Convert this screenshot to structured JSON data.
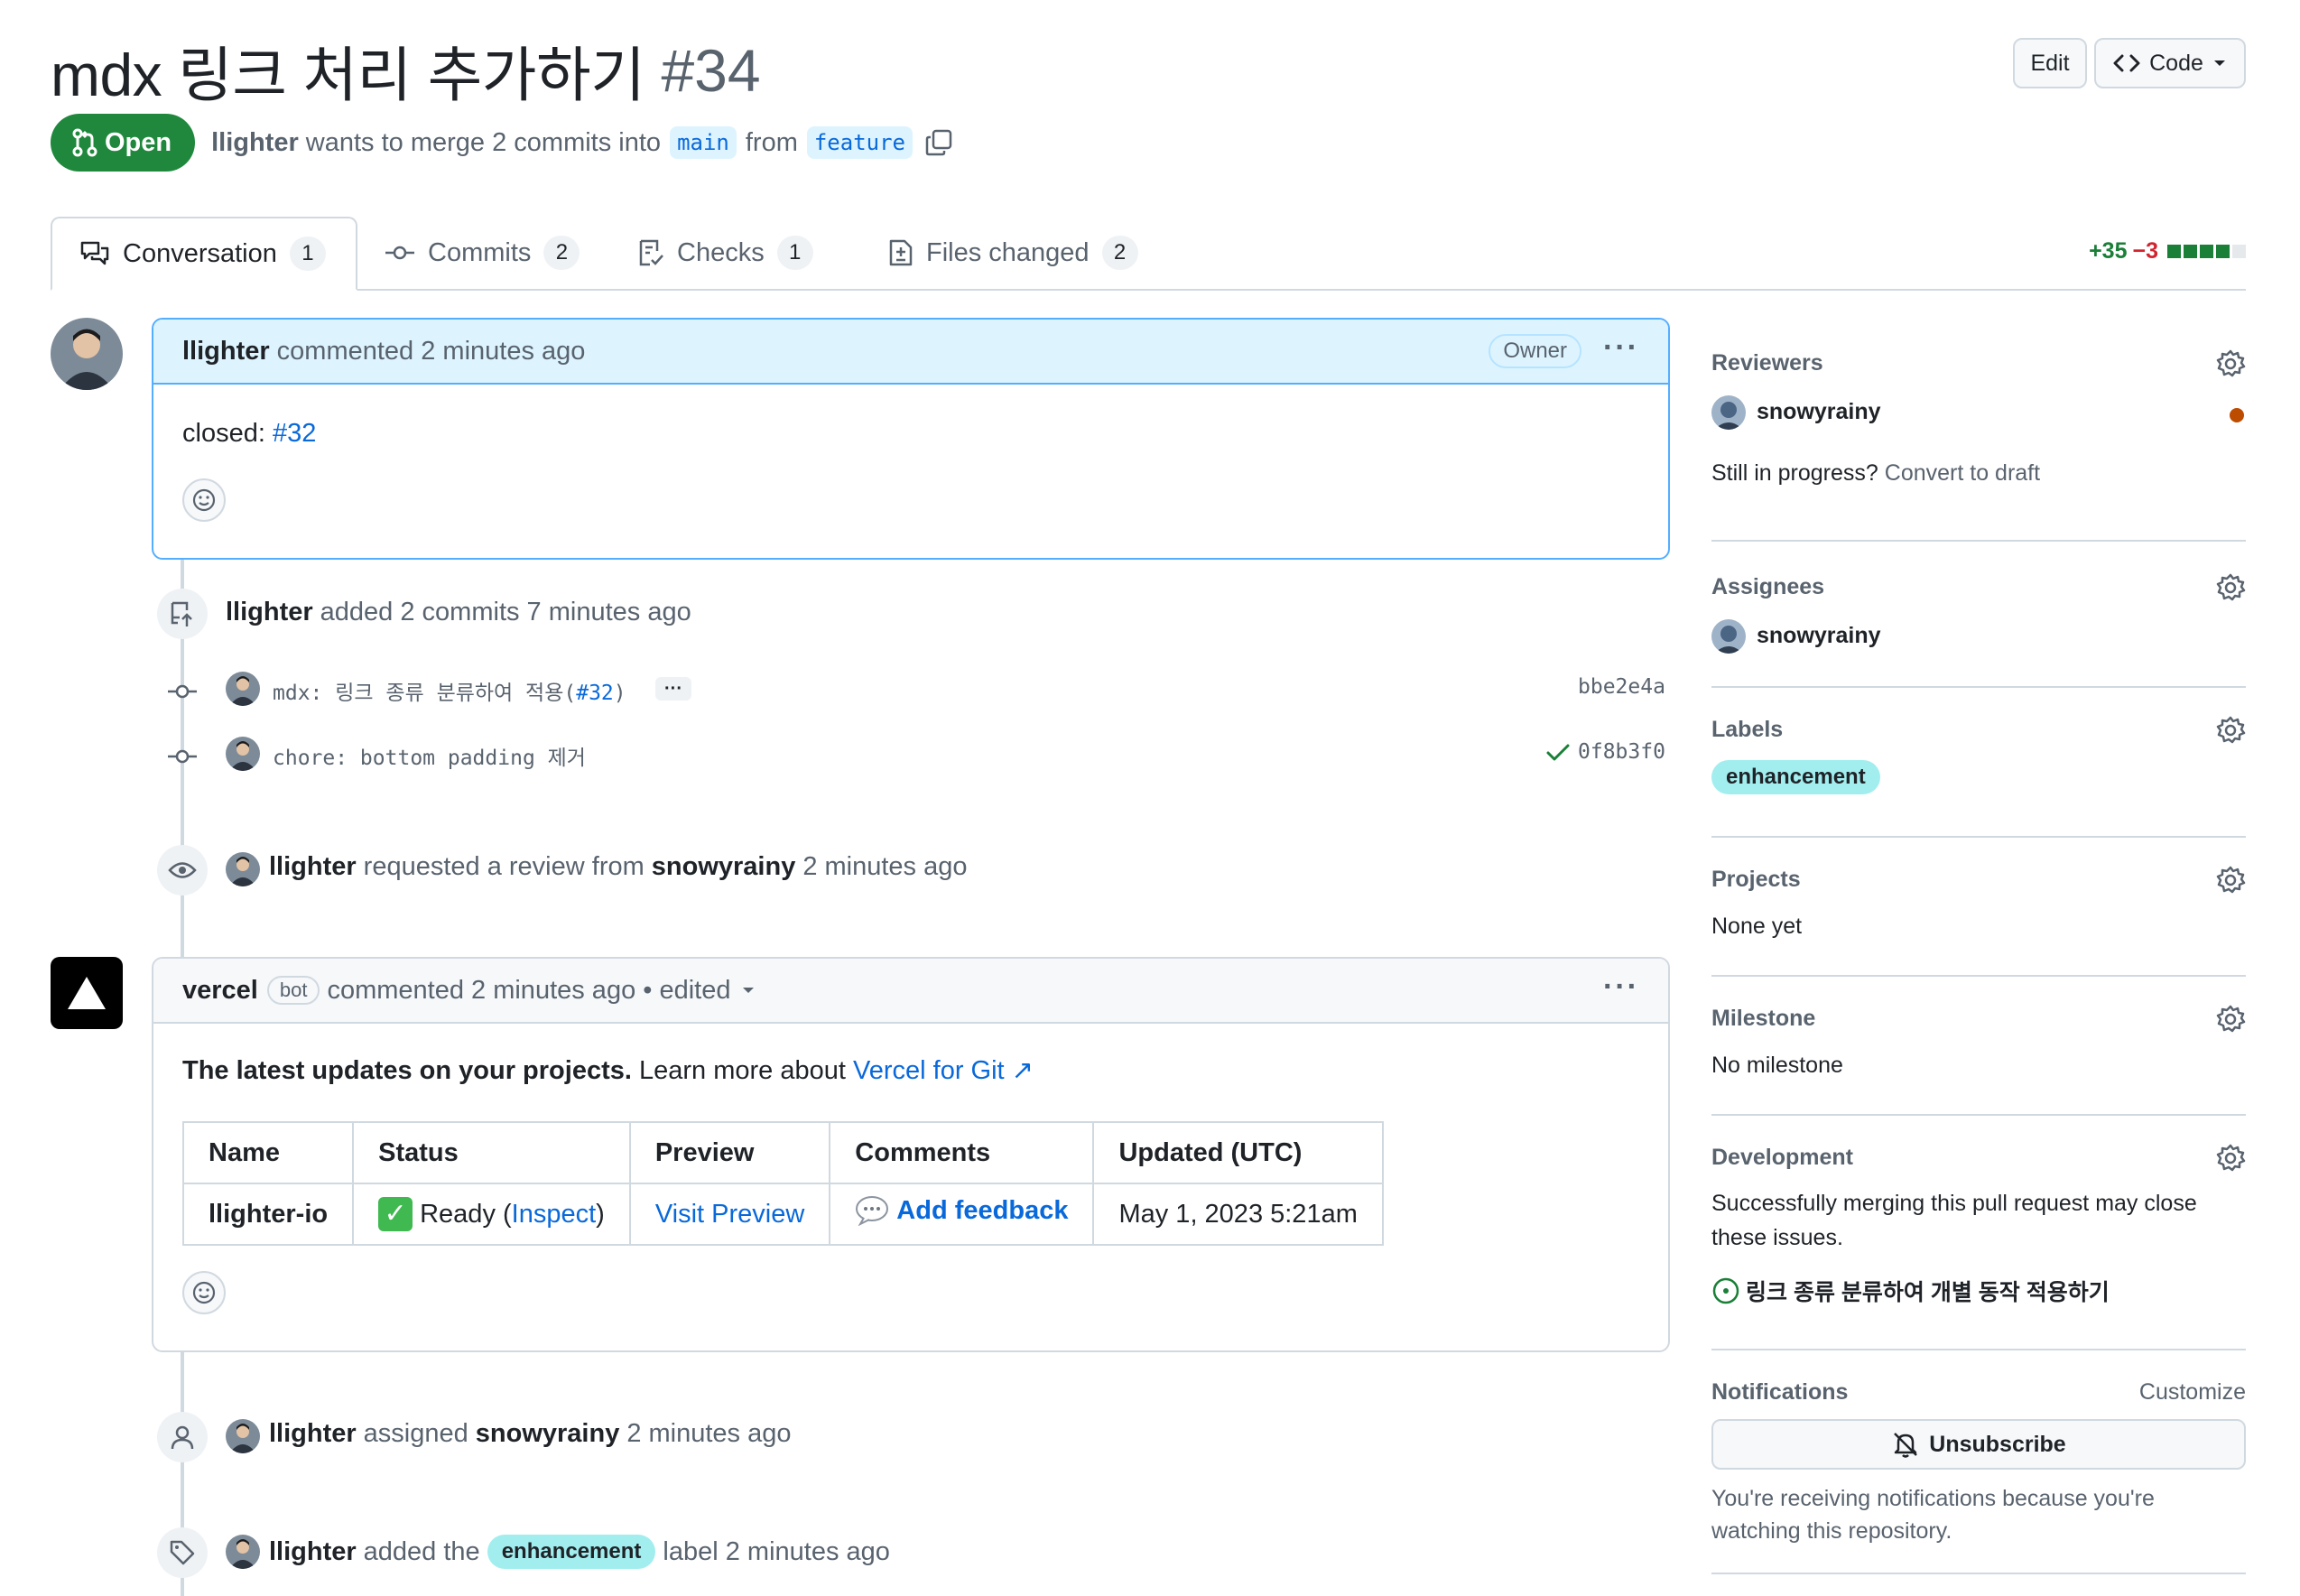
{
  "header": {
    "title": "mdx 링크 처리 추가하기",
    "number": "#34",
    "edit_label": "Edit",
    "code_label": "Code"
  },
  "state": {
    "badge": "Open",
    "author": "llighter",
    "merge_text": "wants to merge 2 commits into",
    "base_branch": "main",
    "from_text": "from",
    "head_branch": "feature"
  },
  "tabs": [
    {
      "label": "Conversation",
      "count": "1"
    },
    {
      "label": "Commits",
      "count": "2"
    },
    {
      "label": "Checks",
      "count": "1"
    },
    {
      "label": "Files changed",
      "count": "2"
    }
  ],
  "diffstat": {
    "additions": "+35",
    "deletions": "−3"
  },
  "first_comment": {
    "author": "llighter",
    "meta": "commented 2 minutes ago",
    "role": "Owner",
    "body_prefix": "closed:",
    "body_link": "#32"
  },
  "commits_event": {
    "author": "llighter",
    "text": "added 2 commits 7 minutes ago",
    "commits": [
      {
        "message_prefix": "mdx: 링크 종류 분류하여 적용(",
        "message_link": "#32",
        "message_suffix": ")",
        "sha": "bbe2e4a"
      },
      {
        "message_prefix": "chore: bottom padding 제거",
        "message_link": "",
        "message_suffix": "",
        "sha": "0f8b3f0"
      }
    ]
  },
  "review_event": {
    "author": "llighter",
    "text": "requested a review from",
    "reviewer": "snowyrainy",
    "time": "2 minutes ago"
  },
  "vercel_comment": {
    "author": "vercel",
    "bot_label": "bot",
    "meta": "commented 2 minutes ago • edited",
    "intro_bold": "The latest updates on your projects.",
    "intro_text": "Learn more about",
    "intro_link": "Vercel for Git ↗",
    "table": {
      "headers": [
        "Name",
        "Status",
        "Preview",
        "Comments",
        "Updated (UTC)"
      ],
      "row": {
        "name": "llighter-io",
        "status_text": "Ready (",
        "status_link": "Inspect",
        "status_close": ")",
        "preview": "Visit Preview",
        "comments": "Add feedback",
        "updated": "May 1, 2023 5:21am"
      }
    }
  },
  "assign_event": {
    "author": "llighter",
    "text": "assigned",
    "assignee": "snowyrainy",
    "time": "2 minutes ago"
  },
  "label_event": {
    "author": "llighter",
    "text": "added the",
    "label": "enhancement",
    "suffix": "label 2 minutes ago"
  },
  "sidebar": {
    "reviewers": {
      "heading": "Reviewers",
      "name": "snowyrainy",
      "draft_q": "Still in progress?",
      "draft_link": "Convert to draft"
    },
    "assignees": {
      "heading": "Assignees",
      "name": "snowyrainy"
    },
    "labels": {
      "heading": "Labels",
      "label": "enhancement"
    },
    "projects": {
      "heading": "Projects",
      "value": "None yet"
    },
    "milestone": {
      "heading": "Milestone",
      "value": "No milestone"
    },
    "development": {
      "heading": "Development",
      "text": "Successfully merging this pull request may close these issues.",
      "issue": "링크 종류 분류하여 개별 동작 적용하기"
    },
    "notifications": {
      "heading": "Notifications",
      "customize": "Customize",
      "button": "Unsubscribe",
      "note": "You're receiving notifications because you're watching this repository."
    }
  },
  "colors": {
    "open_green": "#1f883d",
    "link_blue": "#0969da",
    "label_bg": "#a2eeef",
    "deletion_red": "#d1242f",
    "reviewer_dot": "#bc4c00"
  }
}
